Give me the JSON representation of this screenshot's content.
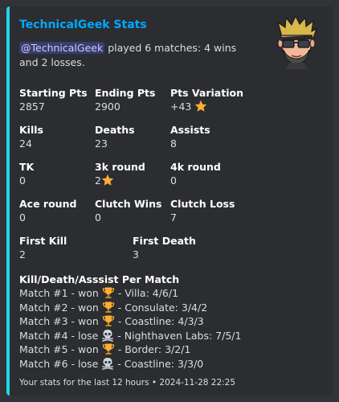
{
  "embed": {
    "accent_color": "#1fd6e4",
    "title": "TechnicalGeek Stats",
    "description": {
      "mention": "@TechnicalGeek",
      "text": " played 6 matches: 4 wins and 2 losses."
    },
    "thumbnail": "avatar-image-cartoon-man-sunglasses"
  },
  "fields_row1": [
    {
      "name": "Starting Pts",
      "value": "2857",
      "emoji": ""
    },
    {
      "name": "Ending Pts",
      "value": "2900",
      "emoji": ""
    },
    {
      "name": "Pts Variation",
      "value": "+43",
      "emoji": "star"
    }
  ],
  "fields_row2": [
    {
      "name": "Kills",
      "value": "24"
    },
    {
      "name": "Deaths",
      "value": "23"
    },
    {
      "name": "Assists",
      "value": "8"
    }
  ],
  "fields_row3": [
    {
      "name": "TK",
      "value": "0"
    },
    {
      "name": "3k round",
      "value": "2",
      "emoji": "star"
    },
    {
      "name": "4k round",
      "value": "0"
    }
  ],
  "fields_row4": [
    {
      "name": "Ace round",
      "value": "0"
    },
    {
      "name": "Clutch Wins",
      "value": "0"
    },
    {
      "name": "Clutch Loss",
      "value": "7"
    }
  ],
  "fields_row5": [
    {
      "name": "First Kill",
      "value": "2"
    },
    {
      "name": "First Death",
      "value": "3"
    }
  ],
  "kda": {
    "heading": "Kill/Death/Asssist Per Match",
    "matches": [
      {
        "prefix": "Match #1 - won ",
        "icon": "trophy",
        "suffix": " - Villa: 4/6/1"
      },
      {
        "prefix": "Match #2 - won ",
        "icon": "trophy",
        "suffix": " - Consulate: 3/4/2"
      },
      {
        "prefix": "Match #3 - won ",
        "icon": "trophy",
        "suffix": " - Coastline: 4/3/3"
      },
      {
        "prefix": "Match #4 - lose ",
        "icon": "skull-crossbones",
        "suffix": " - Nighthaven Labs: 7/5/1"
      },
      {
        "prefix": "Match #5 - won ",
        "icon": "trophy",
        "suffix": " - Border: 3/2/1"
      },
      {
        "prefix": "Match #6 - lose ",
        "icon": "skull-crossbones",
        "suffix": " - Coastline: 3/3/0"
      }
    ]
  },
  "footer": {
    "text": "Your stats for the last 12 hours",
    "separator": " • ",
    "timestamp": "2024-11-28 22:25"
  }
}
